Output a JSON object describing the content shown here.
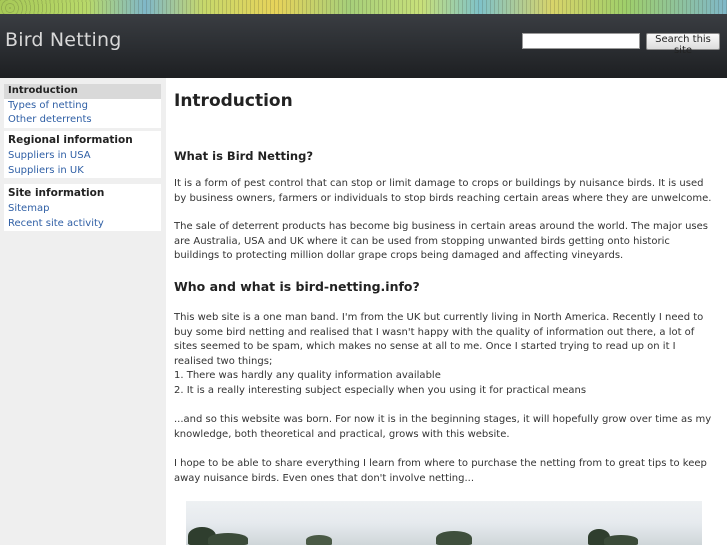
{
  "header": {
    "site_title": "Bird Netting",
    "search_placeholder": "",
    "search_button": "Search this site"
  },
  "sidebar": {
    "group1": [
      "Introduction",
      "Types of netting",
      "Other deterrents"
    ],
    "group2_heading": "Regional information",
    "group2": [
      "Suppliers in USA",
      "Suppliers in UK"
    ],
    "group3_heading": "Site information",
    "group3": [
      "Sitemap",
      "Recent site activity"
    ]
  },
  "main": {
    "title": "Introduction",
    "section1_heading": "What is Bird Netting?",
    "p1": "It is a form of pest control that can stop or limit damage to crops or buildings by nuisance birds.  It is used by business owners, farmers or individuals to stop birds reaching certain areas where they are unwelcome.",
    "p2": "The sale of deterrent products has become big business in certain areas around the world.  The major uses are Australia, USA and UK where it can be used from stopping unwanted birds getting onto historic buildings to protecting million dollar grape crops being damaged and affecting vineyards.",
    "section2_heading": "Who and what is bird-netting.info?",
    "p3": "This web site is a one man band.  I'm from the UK but currently living in North America.  Recently I need to buy some bird netting and realised that I wasn't happy with the quality of information out there, a lot of sites seemed to be spam, which makes no sense at all to me.  Once I started trying to read up on it I realised two things;",
    "list1": "1. There was hardly any quality information available",
    "list2": "2. It is a really interesting subject especially when you using it for practical means",
    "p4": "...and so this website was born.  For now it is in the beginning stages, it will hopefully grow over time as my knowledge, both theoretical and practical, grows with this website.",
    "p5": "I hope to be able to share everything I learn from where to purchase the netting from to great tips to keep away nuisance birds.  Even ones that don't involve netting..."
  }
}
